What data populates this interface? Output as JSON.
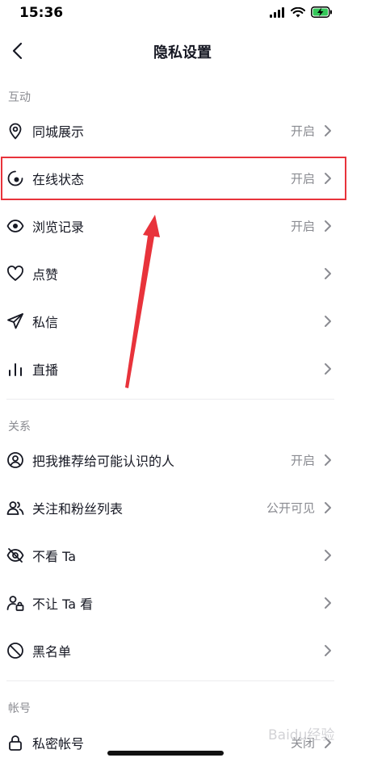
{
  "status_bar": {
    "time": "15:36"
  },
  "nav": {
    "title": "隐私设置"
  },
  "sections": [
    {
      "title": "互动",
      "items": [
        {
          "label": "同城展示",
          "value": "开启",
          "icon": "location-pin-icon"
        },
        {
          "label": "在线状态",
          "value": "开启",
          "icon": "online-status-icon"
        },
        {
          "label": "浏览记录",
          "value": "开启",
          "icon": "eye-icon"
        },
        {
          "label": "点赞",
          "value": "",
          "icon": "heart-icon"
        },
        {
          "label": "私信",
          "value": "",
          "icon": "paper-plane-icon"
        },
        {
          "label": "直播",
          "value": "",
          "icon": "live-bars-icon"
        }
      ]
    },
    {
      "title": "关系",
      "items": [
        {
          "label": "把我推荐给可能认识的人",
          "value": "开启",
          "icon": "user-circle-icon"
        },
        {
          "label": "关注和粉丝列表",
          "value": "公开可见",
          "icon": "users-icon"
        },
        {
          "label": "不看 Ta",
          "value": "",
          "icon": "eye-off-icon"
        },
        {
          "label": "不让 Ta 看",
          "value": "",
          "icon": "user-lock-icon"
        },
        {
          "label": "黑名单",
          "value": "",
          "icon": "block-icon"
        }
      ]
    },
    {
      "title": "帐号",
      "items": [
        {
          "label": "私密帐号",
          "value": "关闭",
          "icon": "lock-icon"
        }
      ]
    }
  ],
  "colors": {
    "highlight": "#e8333b",
    "text": "#161823",
    "secondary": "#8a8b91"
  },
  "watermark": "Baidu经验"
}
